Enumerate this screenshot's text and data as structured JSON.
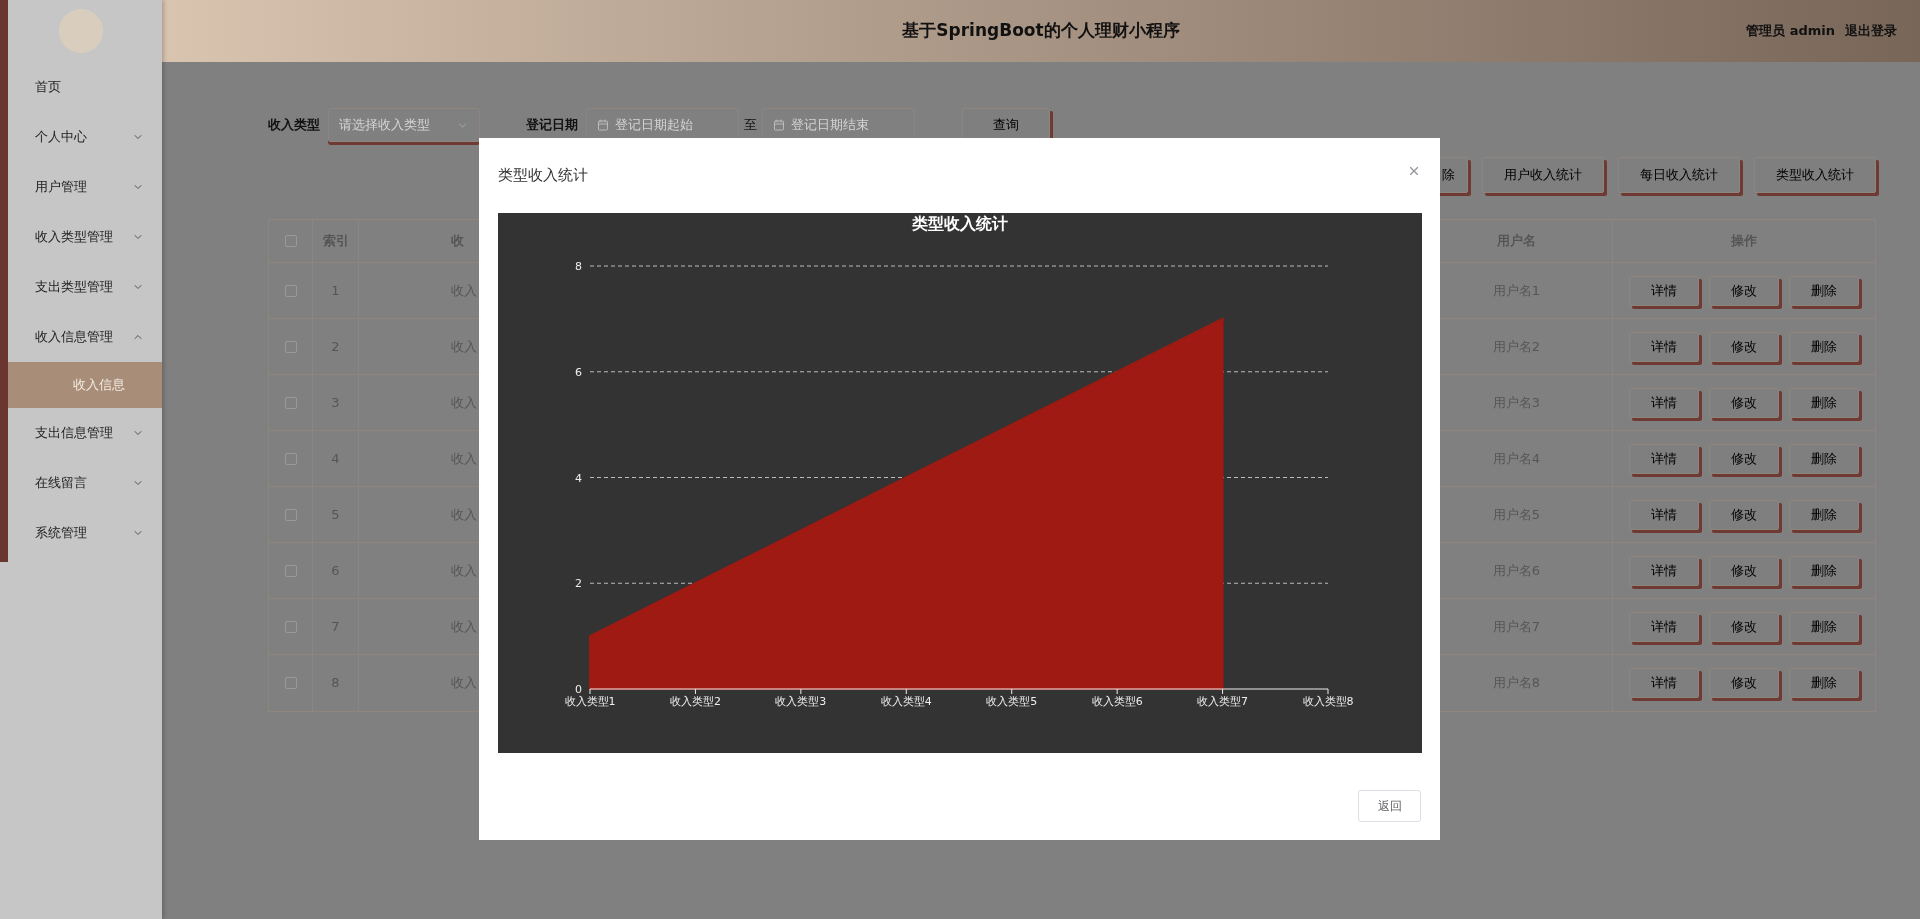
{
  "header": {
    "title": "基于SpringBoot的个人理财小程序",
    "user": "管理员 admin",
    "logout": "退出登录"
  },
  "sidebar": {
    "items": [
      {
        "label": "首页",
        "kind": "link"
      },
      {
        "label": "个人中心",
        "kind": "menu",
        "expanded": false
      },
      {
        "label": "用户管理",
        "kind": "menu",
        "expanded": false
      },
      {
        "label": "收入类型管理",
        "kind": "menu",
        "expanded": false
      },
      {
        "label": "支出类型管理",
        "kind": "menu",
        "expanded": false
      },
      {
        "label": "收入信息管理",
        "kind": "menu",
        "expanded": true,
        "children": [
          {
            "label": "收入信息",
            "selected": true
          }
        ]
      },
      {
        "label": "支出信息管理",
        "kind": "menu",
        "expanded": false
      },
      {
        "label": "在线留言",
        "kind": "menu",
        "expanded": false
      },
      {
        "label": "系统管理",
        "kind": "menu",
        "expanded": false
      }
    ]
  },
  "search": {
    "type_label": "收入类型",
    "type_placeholder": "请选择收入类型",
    "date_label": "登记日期",
    "date_start_placeholder": "登记日期起始",
    "date_separator": "至",
    "date_end_placeholder": "登记日期结束",
    "button": "查询"
  },
  "toolbar": [
    "除",
    "用户收入统计",
    "每日收入统计",
    "类型收入统计"
  ],
  "table": {
    "header_checked": false,
    "columns": [
      "索引",
      "收",
      "用户名",
      "操作"
    ],
    "rows": [
      {
        "index": "1",
        "column_3": "收入",
        "username": "用户名1",
        "checked": false,
        "actions": [
          "详情",
          "修改",
          "删除"
        ]
      },
      {
        "index": "2",
        "column_3": "收入",
        "username": "用户名2",
        "checked": false,
        "actions": [
          "详情",
          "修改",
          "删除"
        ]
      },
      {
        "index": "3",
        "column_3": "收入",
        "username": "用户名3",
        "checked": false,
        "actions": [
          "详情",
          "修改",
          "删除"
        ]
      },
      {
        "index": "4",
        "column_3": "收入",
        "username": "用户名4",
        "checked": false,
        "actions": [
          "详情",
          "修改",
          "删除"
        ]
      },
      {
        "index": "5",
        "column_3": "收入",
        "username": "用户名5",
        "checked": false,
        "actions": [
          "详情",
          "修改",
          "删除"
        ]
      },
      {
        "index": "6",
        "column_3": "收入",
        "username": "用户名6",
        "checked": false,
        "actions": [
          "详情",
          "修改",
          "删除"
        ]
      },
      {
        "index": "7",
        "column_3": "收入",
        "username": "用户名7",
        "checked": false,
        "actions": [
          "详情",
          "修改",
          "删除"
        ]
      },
      {
        "index": "8",
        "column_3": "收入",
        "username": "用户名8",
        "checked": false,
        "actions": [
          "详情",
          "修改",
          "删除"
        ]
      }
    ]
  },
  "modal": {
    "title": "类型收入统计",
    "back_button": "返回",
    "chart_data": {
      "type": "area",
      "title": "类型收入统计",
      "categories": [
        "收入类型1",
        "收入类型2",
        "收入类型3",
        "收入类型4",
        "收入类型5",
        "收入类型6",
        "收入类型7",
        "收入类型8"
      ],
      "grid": true,
      "series": [
        {
          "color": "#9e1a12",
          "values": [
            1,
            2,
            3,
            4,
            5,
            6,
            7,
            null
          ]
        }
      ],
      "ylim": [
        0,
        8
      ],
      "yticks": [
        0,
        2,
        4,
        6,
        8
      ]
    }
  }
}
